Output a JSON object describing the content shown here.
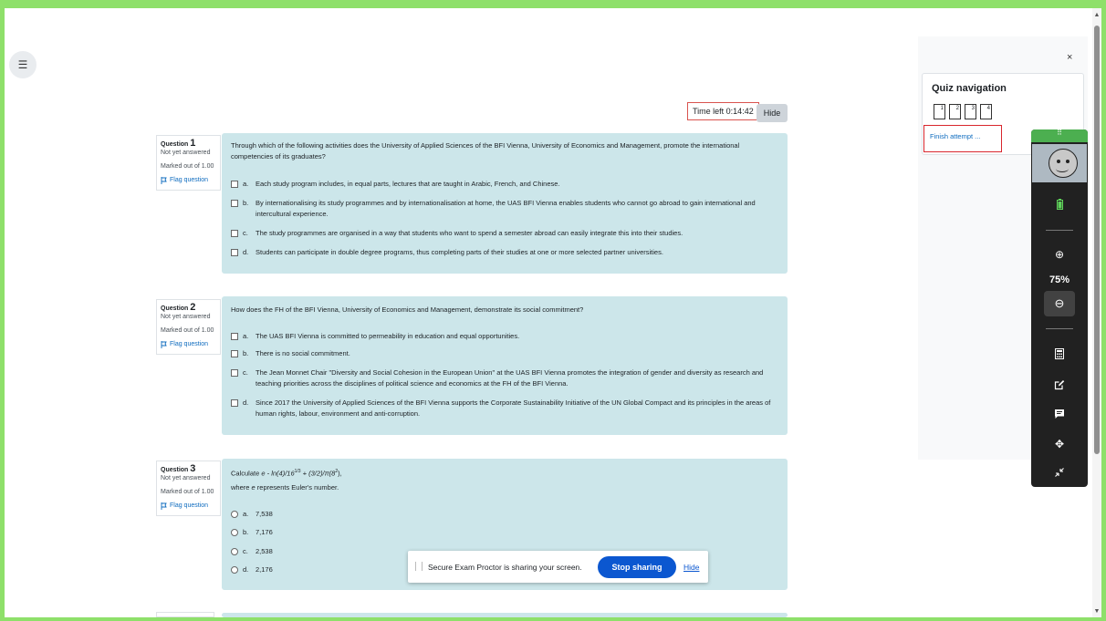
{
  "timer": {
    "text": "Time left 0:14:42",
    "hide_label": "Hide"
  },
  "questions": [
    {
      "label": "Question",
      "number": "1",
      "status": "Not yet answered",
      "marked": "Marked out of 1.00",
      "flag": "Flag question",
      "text": "Through which of the following activities does the University of Applied Sciences of the BFI Vienna, University of Economics and Management, promote the international competencies of its graduates?",
      "answers": [
        {
          "letter": "a.",
          "text": "Each study program includes, in equal parts, lectures that are taught in Arabic, French, and Chinese."
        },
        {
          "letter": "b.",
          "text": "By internationalising its study programmes and by internationalisation at home, the UAS BFI Vienna enables students who cannot go abroad to gain international and intercultural experience."
        },
        {
          "letter": "c.",
          "text": "The study programmes are organised in a way that students who want to spend a semester abroad can easily integrate this into their studies."
        },
        {
          "letter": "d.",
          "text": "Students can participate in double degree programs, thus completing parts of their studies at one or more selected partner universities."
        }
      ]
    },
    {
      "label": "Question",
      "number": "2",
      "status": "Not yet answered",
      "marked": "Marked out of 1.00",
      "flag": "Flag question",
      "text": "How does the FH of the BFI Vienna, University of Economics and Management, demonstrate its social commitment?",
      "answers": [
        {
          "letter": "a.",
          "text": "The UAS BFI Vienna is committed to permeability in education and equal opportunities."
        },
        {
          "letter": "b.",
          "text": "There is no social commitment."
        },
        {
          "letter": "c.",
          "text": "The Jean Monnet Chair \"Diversity and Social Cohesion in the European Union\" at the UAS BFI Vienna promotes the integration of gender and diversity as research and teaching priorities across the disciplines of political science and economics at the FH of the BFI Vienna."
        },
        {
          "letter": "d.",
          "text": "Since 2017 the University of Applied Sciences of the BFI Vienna supports the Corporate Sustainability Initiative of the UN Global Compact and its principles in the areas of human rights, labour, environment and anti-corruption."
        }
      ]
    },
    {
      "label": "Question",
      "number": "3",
      "status": "Not yet answered",
      "marked": "Marked out of 1.00",
      "flag": "Flag question",
      "formula_prefix": "Calculate ",
      "formula_e": "e",
      "formula_mid": " - ln(4)/16",
      "formula_sup1": "1/3",
      "formula_mid2": " + (3/2)/π(8",
      "formula_sup2": "2",
      "formula_end": "),",
      "subtext_prefix": "where ",
      "subtext_e": "e",
      "subtext_suffix": " represents Euler's number.",
      "answers": [
        {
          "letter": "a.",
          "text": "7,538"
        },
        {
          "letter": "b.",
          "text": "7,176"
        },
        {
          "letter": "c.",
          "text": "2,538"
        },
        {
          "letter": "d.",
          "text": "2,176"
        }
      ]
    }
  ],
  "nav": {
    "title": "Quiz navigation",
    "buttons": [
      "1",
      "2",
      "3",
      "4"
    ],
    "finish": "Finish attempt ...",
    "close": "×"
  },
  "toolbar": {
    "zoom": "75%"
  },
  "share": {
    "message": "Secure Exam Proctor is sharing your screen.",
    "stop": "Stop sharing",
    "hide": "Hide"
  },
  "icons": {
    "drawer": "list-icon",
    "zoom_in": "plus-circle-icon",
    "zoom_out": "minus-circle-icon",
    "calculator": "calculator-icon",
    "notes": "edit-icon",
    "chat": "chat-icon",
    "move": "move-icon",
    "collapse": "collapse-icon",
    "battery": "battery-icon",
    "flag": "flag-icon"
  },
  "colors": {
    "frame": "#8ee06a",
    "question_bg": "#cce6ea",
    "accent": "#0f6cbf",
    "highlight": "#d9262d",
    "stop_button": "#0b57d0"
  }
}
